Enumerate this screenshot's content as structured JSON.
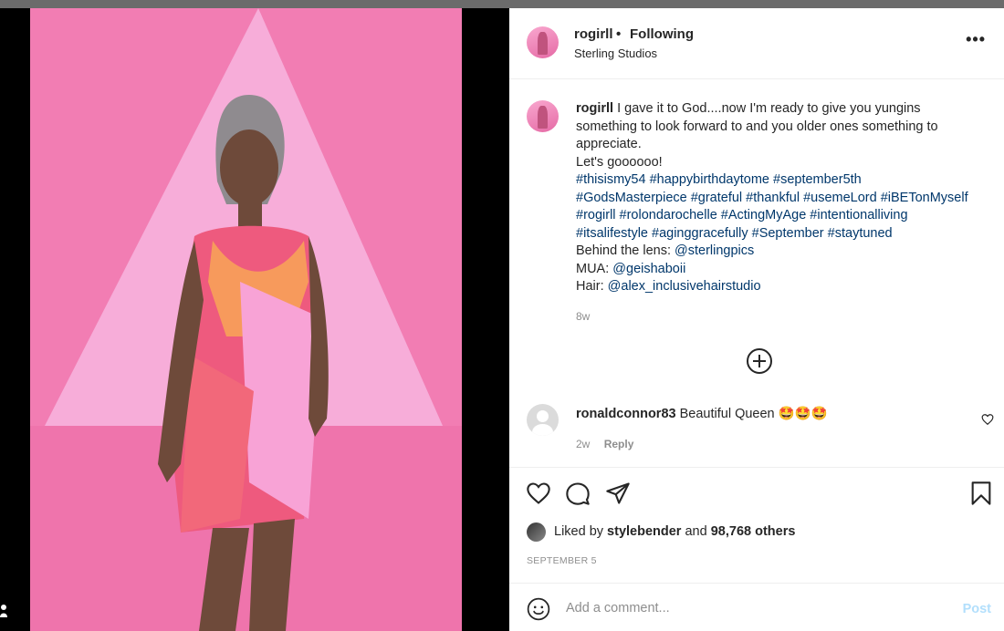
{
  "post": {
    "username": "rogirll",
    "separator": "•",
    "follow_status": "Following",
    "location": "Sterling Studios",
    "more_icon": "more-horizontal-icon"
  },
  "caption": {
    "username": "rogirll",
    "lines": [
      "I gave it to God....now I'm ready to give you yungins",
      "something to look forward to and you older ones something to",
      "appreciate.",
      "Let's goooooo!"
    ],
    "hashtag_lines": [
      "#thisismy54 #happybirthdaytome #september5th",
      "#GodsMasterpiece #grateful #thankful #usemeLord #iBETonMyself",
      "#rogirll #rolondarochelle #ActingMyAge #intentionalliving",
      "#itsalifestyle #aginggracefully #September #staytuned"
    ],
    "credits": [
      {
        "label": "Behind the lens:",
        "handle": "@sterlingpics"
      },
      {
        "label": "MUA:",
        "handle": "@geishaboii"
      },
      {
        "label": "Hair:",
        "handle": "@alex_inclusivehairstudio"
      }
    ],
    "time_ago": "8w"
  },
  "comments": [
    {
      "username": "ronaldconnor83",
      "text": "Beautiful Queen 🤩🤩🤩",
      "time_ago": "2w",
      "reply_label": "Reply"
    }
  ],
  "likes": {
    "prefix": "Liked by",
    "liked_by": "stylebender",
    "connector": "and",
    "others": "98,768 others"
  },
  "post_date": "SEPTEMBER 5",
  "add_comment": {
    "placeholder": "Add a comment...",
    "post_label": "Post"
  },
  "colors": {
    "link": "#00376b",
    "muted": "#8e8e8e",
    "post_disabled": "#b2dffc",
    "photo_background": "#f07ab0"
  }
}
